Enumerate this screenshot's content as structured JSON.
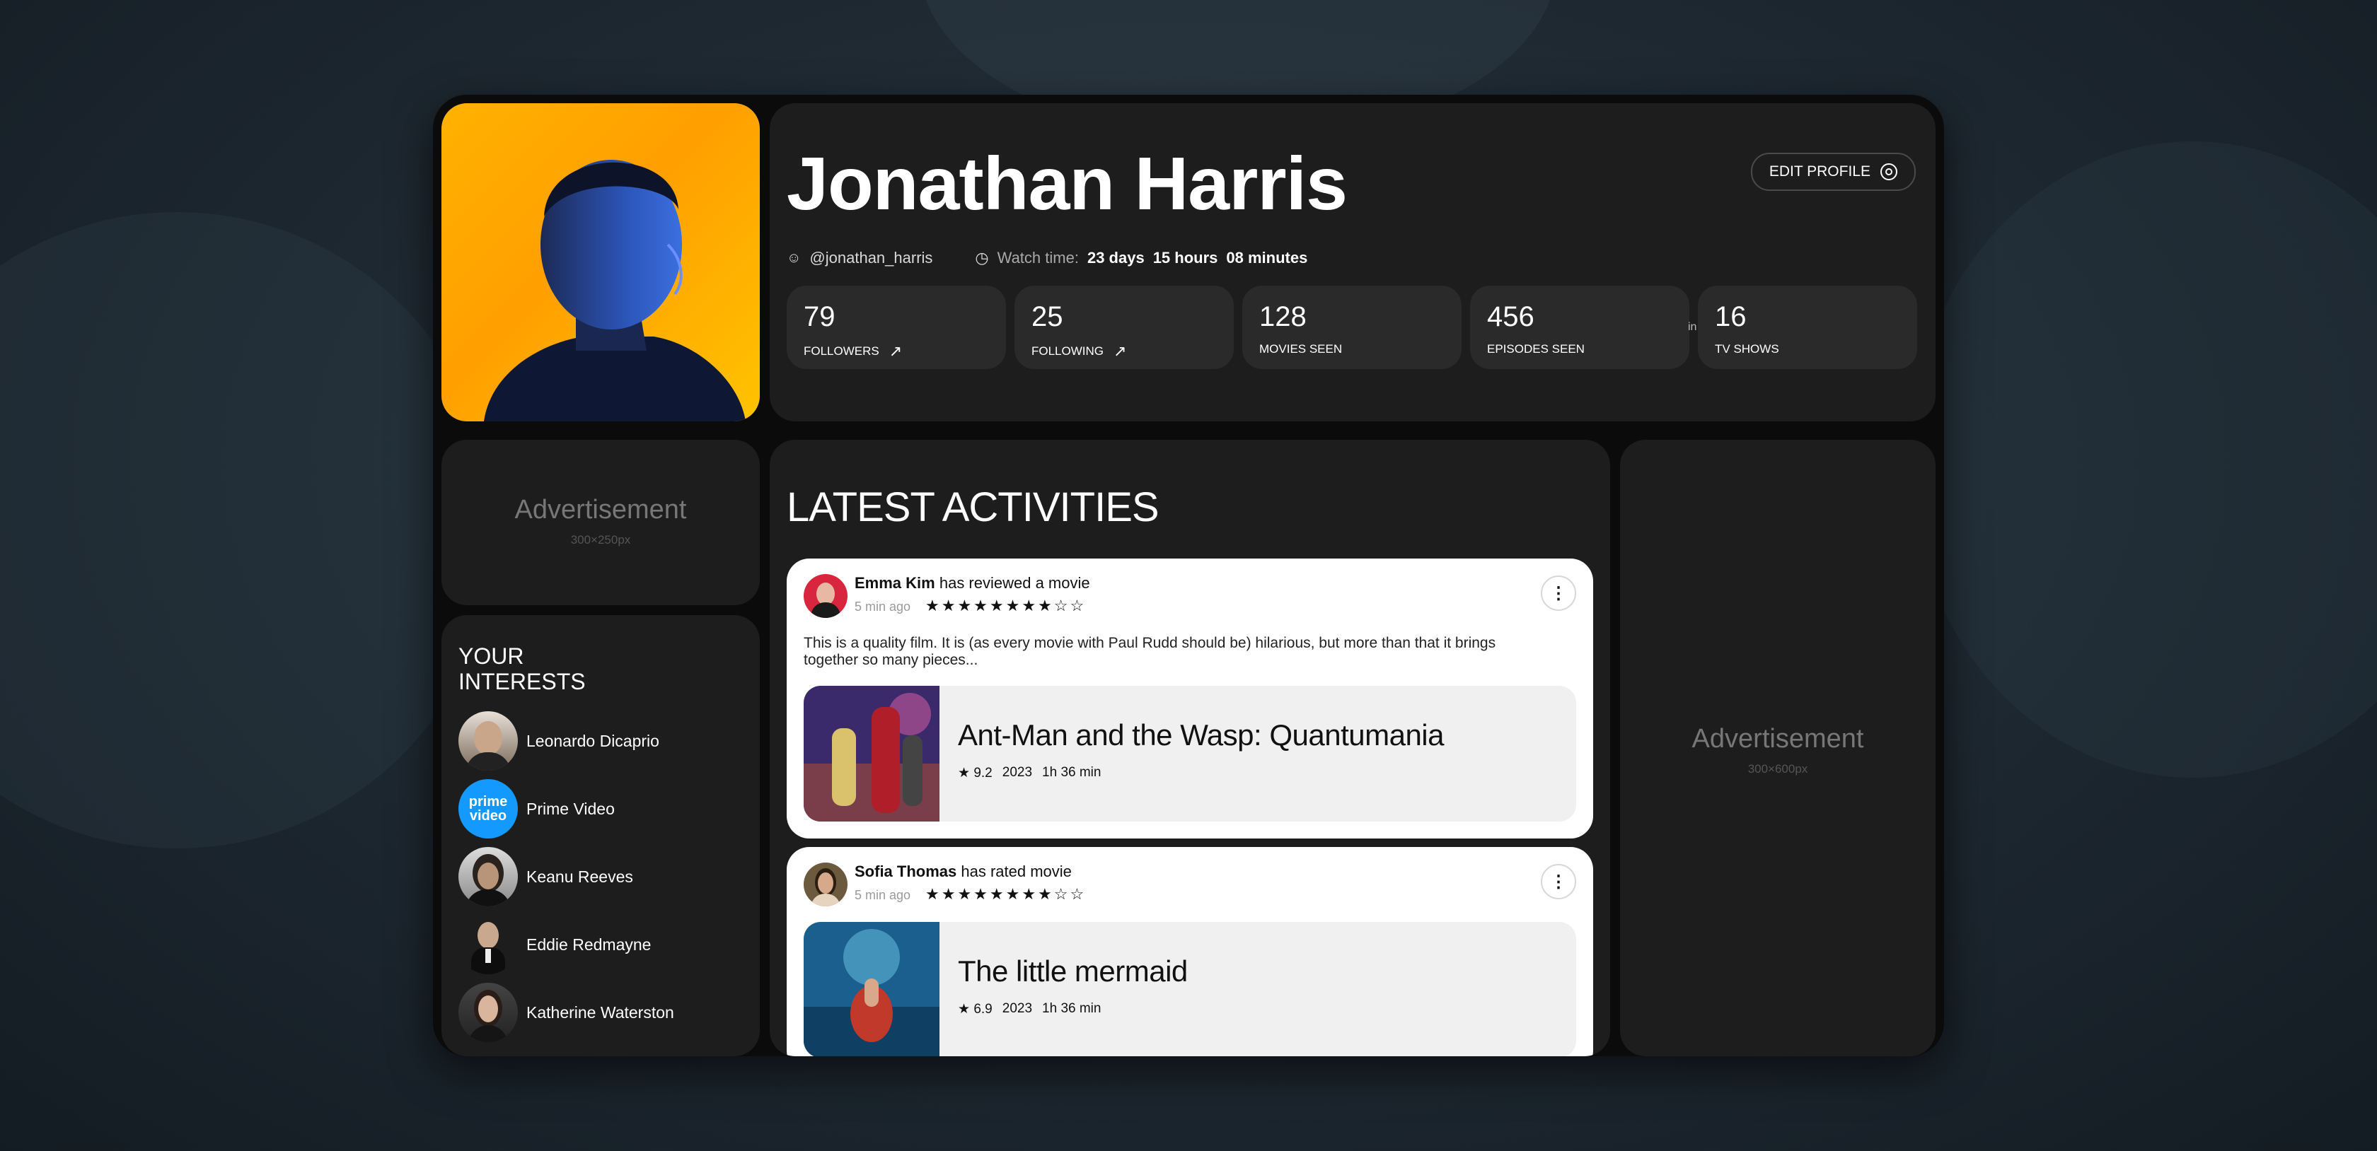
{
  "profile": {
    "name": "Jonathan Harris",
    "handle": "@jonathan_harris",
    "edit_label": "EDIT PROFILE",
    "watch_label": "Watch time:",
    "watch_days": "23 days",
    "watch_hours": "15 hours",
    "watch_minutes": "08 minutes"
  },
  "stats": [
    {
      "value": "79",
      "label": "FOLLOWERS"
    },
    {
      "value": "25",
      "label": "FOLLOWING"
    },
    {
      "value": "128",
      "label": "MOVIES SEEN"
    },
    {
      "value": "456",
      "label": "EPISODES SEEN"
    },
    {
      "value": "16",
      "label": "TV SHOWS"
    }
  ],
  "stats_separator": "in",
  "ads": {
    "left": {
      "title": "Advertisement",
      "size": "300×250px"
    },
    "right": {
      "title": "Advertisement",
      "size": "300×600px"
    }
  },
  "interests": {
    "title": "YOUR INTERESTS",
    "items": [
      {
        "name": "Leonardo Dicaprio"
      },
      {
        "name": "Prime Video",
        "logo_text": "prime video"
      },
      {
        "name": "Keanu Reeves"
      },
      {
        "name": "Eddie Redmayne"
      },
      {
        "name": "Katherine Waterston"
      }
    ]
  },
  "activities": {
    "title": "LATEST ACTIVITIES",
    "items": [
      {
        "user": "Emma Kim",
        "action": "has reviewed a movie",
        "time": "5 min ago",
        "stars": "★★★★★★★★☆☆",
        "review": "This is a quality film. It is (as every movie with Paul Rudd should be) hilarious, but more than that it brings together so many pieces...",
        "movie": {
          "title": "Ant-Man and the Wasp: Quantumania",
          "rating": "9.2",
          "year": "2023",
          "duration": "1h 36 min"
        }
      },
      {
        "user": "Sofia Thomas",
        "action": "has rated movie",
        "time": "5 min ago",
        "stars": "★★★★★★★★☆☆",
        "movie": {
          "title": "The little mermaid",
          "rating": "6.9",
          "year": "2023",
          "duration": "1h 36 min"
        }
      }
    ]
  },
  "colors": {
    "accent": "#ffb200",
    "panel": "#1d1d1d",
    "stat": "#2a2a2a",
    "prime": "#1399ff"
  }
}
